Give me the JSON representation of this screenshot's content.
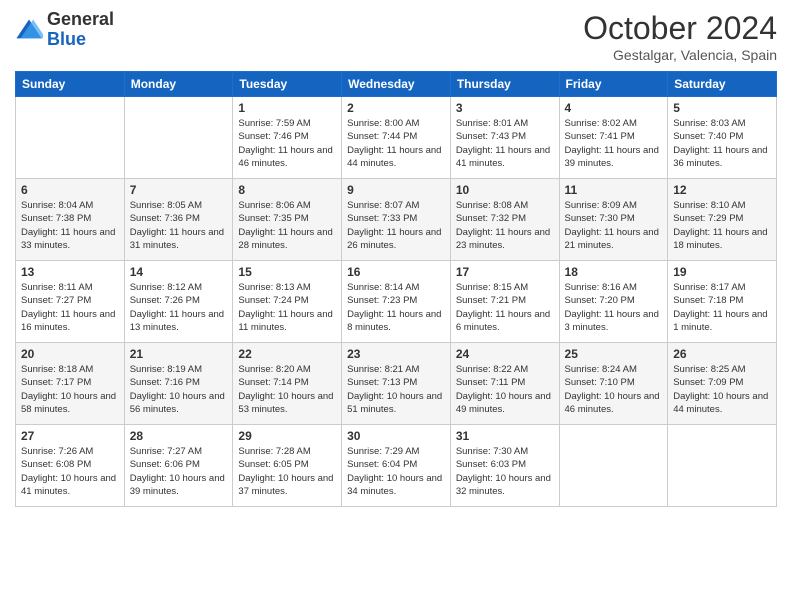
{
  "header": {
    "logo": {
      "general": "General",
      "blue": "Blue"
    },
    "title": "October 2024",
    "subtitle": "Gestalgar, Valencia, Spain"
  },
  "weekdays": [
    "Sunday",
    "Monday",
    "Tuesday",
    "Wednesday",
    "Thursday",
    "Friday",
    "Saturday"
  ],
  "weeks": [
    [
      {
        "day": "",
        "info": ""
      },
      {
        "day": "",
        "info": ""
      },
      {
        "day": "1",
        "info": "Sunrise: 7:59 AM\nSunset: 7:46 PM\nDaylight: 11 hours and 46 minutes."
      },
      {
        "day": "2",
        "info": "Sunrise: 8:00 AM\nSunset: 7:44 PM\nDaylight: 11 hours and 44 minutes."
      },
      {
        "day": "3",
        "info": "Sunrise: 8:01 AM\nSunset: 7:43 PM\nDaylight: 11 hours and 41 minutes."
      },
      {
        "day": "4",
        "info": "Sunrise: 8:02 AM\nSunset: 7:41 PM\nDaylight: 11 hours and 39 minutes."
      },
      {
        "day": "5",
        "info": "Sunrise: 8:03 AM\nSunset: 7:40 PM\nDaylight: 11 hours and 36 minutes."
      }
    ],
    [
      {
        "day": "6",
        "info": "Sunrise: 8:04 AM\nSunset: 7:38 PM\nDaylight: 11 hours and 33 minutes."
      },
      {
        "day": "7",
        "info": "Sunrise: 8:05 AM\nSunset: 7:36 PM\nDaylight: 11 hours and 31 minutes."
      },
      {
        "day": "8",
        "info": "Sunrise: 8:06 AM\nSunset: 7:35 PM\nDaylight: 11 hours and 28 minutes."
      },
      {
        "day": "9",
        "info": "Sunrise: 8:07 AM\nSunset: 7:33 PM\nDaylight: 11 hours and 26 minutes."
      },
      {
        "day": "10",
        "info": "Sunrise: 8:08 AM\nSunset: 7:32 PM\nDaylight: 11 hours and 23 minutes."
      },
      {
        "day": "11",
        "info": "Sunrise: 8:09 AM\nSunset: 7:30 PM\nDaylight: 11 hours and 21 minutes."
      },
      {
        "day": "12",
        "info": "Sunrise: 8:10 AM\nSunset: 7:29 PM\nDaylight: 11 hours and 18 minutes."
      }
    ],
    [
      {
        "day": "13",
        "info": "Sunrise: 8:11 AM\nSunset: 7:27 PM\nDaylight: 11 hours and 16 minutes."
      },
      {
        "day": "14",
        "info": "Sunrise: 8:12 AM\nSunset: 7:26 PM\nDaylight: 11 hours and 13 minutes."
      },
      {
        "day": "15",
        "info": "Sunrise: 8:13 AM\nSunset: 7:24 PM\nDaylight: 11 hours and 11 minutes."
      },
      {
        "day": "16",
        "info": "Sunrise: 8:14 AM\nSunset: 7:23 PM\nDaylight: 11 hours and 8 minutes."
      },
      {
        "day": "17",
        "info": "Sunrise: 8:15 AM\nSunset: 7:21 PM\nDaylight: 11 hours and 6 minutes."
      },
      {
        "day": "18",
        "info": "Sunrise: 8:16 AM\nSunset: 7:20 PM\nDaylight: 11 hours and 3 minutes."
      },
      {
        "day": "19",
        "info": "Sunrise: 8:17 AM\nSunset: 7:18 PM\nDaylight: 11 hours and 1 minute."
      }
    ],
    [
      {
        "day": "20",
        "info": "Sunrise: 8:18 AM\nSunset: 7:17 PM\nDaylight: 10 hours and 58 minutes."
      },
      {
        "day": "21",
        "info": "Sunrise: 8:19 AM\nSunset: 7:16 PM\nDaylight: 10 hours and 56 minutes."
      },
      {
        "day": "22",
        "info": "Sunrise: 8:20 AM\nSunset: 7:14 PM\nDaylight: 10 hours and 53 minutes."
      },
      {
        "day": "23",
        "info": "Sunrise: 8:21 AM\nSunset: 7:13 PM\nDaylight: 10 hours and 51 minutes."
      },
      {
        "day": "24",
        "info": "Sunrise: 8:22 AM\nSunset: 7:11 PM\nDaylight: 10 hours and 49 minutes."
      },
      {
        "day": "25",
        "info": "Sunrise: 8:24 AM\nSunset: 7:10 PM\nDaylight: 10 hours and 46 minutes."
      },
      {
        "day": "26",
        "info": "Sunrise: 8:25 AM\nSunset: 7:09 PM\nDaylight: 10 hours and 44 minutes."
      }
    ],
    [
      {
        "day": "27",
        "info": "Sunrise: 7:26 AM\nSunset: 6:08 PM\nDaylight: 10 hours and 41 minutes."
      },
      {
        "day": "28",
        "info": "Sunrise: 7:27 AM\nSunset: 6:06 PM\nDaylight: 10 hours and 39 minutes."
      },
      {
        "day": "29",
        "info": "Sunrise: 7:28 AM\nSunset: 6:05 PM\nDaylight: 10 hours and 37 minutes."
      },
      {
        "day": "30",
        "info": "Sunrise: 7:29 AM\nSunset: 6:04 PM\nDaylight: 10 hours and 34 minutes."
      },
      {
        "day": "31",
        "info": "Sunrise: 7:30 AM\nSunset: 6:03 PM\nDaylight: 10 hours and 32 minutes."
      },
      {
        "day": "",
        "info": ""
      },
      {
        "day": "",
        "info": ""
      }
    ]
  ]
}
